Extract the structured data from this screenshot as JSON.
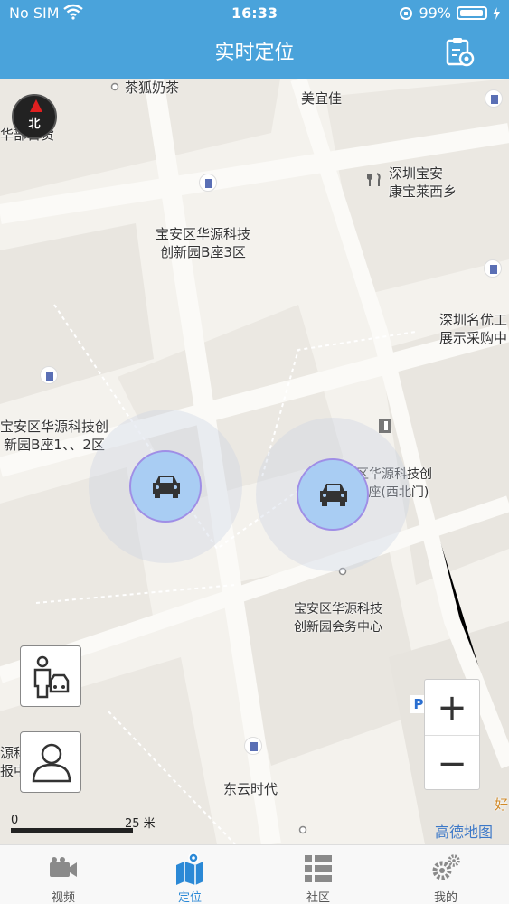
{
  "status_bar": {
    "carrier": "No SIM",
    "time": "16:33",
    "battery": "99%"
  },
  "header": {
    "title": "实时定位"
  },
  "map": {
    "compass_label": "北",
    "places": {
      "tea": "茶狐奶茶",
      "meiyijia": "美宜佳",
      "huabu": "华部百货",
      "kangbao_1": "深圳宝安",
      "kangbao_2": "康宝莱西乡",
      "b3_1": "宝安区华源科技",
      "b3_2": "创新园B座3区",
      "mingyou_1": "深圳名优工",
      "mingyou_2": "展示采购中",
      "b12_1": "宝安区华源科技创",
      "b12_2": "新园B座1、、2区",
      "c_1": "宝安区华源科技创",
      "c_2": "新园C座(西北门)",
      "hui_1": "宝安区华源科技",
      "hui_2": "创新园会务中心",
      "dongyun": "东云时代",
      "yuan_1": "源科",
      "yuan_2": "报中",
      "hao": "好"
    },
    "parking_label": "P",
    "zoom_in": "+",
    "zoom_out": "−",
    "scale_zero": "0",
    "scale_value": "25 米",
    "brand": "高德地图"
  },
  "tabs": [
    {
      "label": "视频",
      "icon": "video-camera-icon",
      "active": false
    },
    {
      "label": "定位",
      "icon": "map-pin-icon",
      "active": true
    },
    {
      "label": "社区",
      "icon": "list-icon",
      "active": false
    },
    {
      "label": "我的",
      "icon": "gears-icon",
      "active": false
    }
  ],
  "colors": {
    "header": "#4aa3db",
    "active_tab": "#2b89d6",
    "car_fill": "#a9cdf3"
  }
}
